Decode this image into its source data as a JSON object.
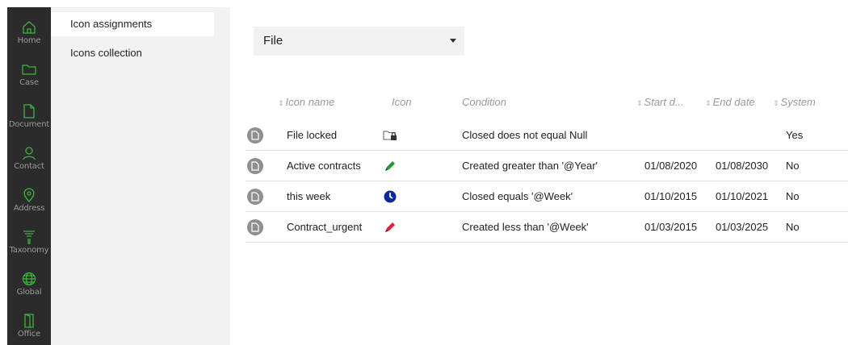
{
  "rail": {
    "items": [
      {
        "label": "Home",
        "icon": "home-icon"
      },
      {
        "label": "Case",
        "icon": "folder-icon"
      },
      {
        "label": "Document",
        "icon": "document-icon"
      },
      {
        "label": "Contact",
        "icon": "person-icon"
      },
      {
        "label": "Address",
        "icon": "location-pin-icon"
      },
      {
        "label": "Taxonomy",
        "icon": "funnel-icon"
      },
      {
        "label": "Global",
        "icon": "globe-icon"
      },
      {
        "label": "Office",
        "icon": "door-icon"
      }
    ],
    "accent": "#3db23d"
  },
  "subnav": {
    "items": [
      {
        "label": "Icon assignments",
        "active": true
      },
      {
        "label": "Icons collection",
        "active": false
      }
    ]
  },
  "filter": {
    "selected": "File"
  },
  "table": {
    "columns": [
      "Icon name",
      "Icon",
      "Condition",
      "Start d...",
      "End date",
      "System"
    ],
    "rows": [
      {
        "name": "File locked",
        "icon": "folder-lock-icon",
        "condition": "Closed does not equal Null",
        "start": "",
        "end": "",
        "system": "Yes"
      },
      {
        "name": "Active contracts",
        "icon": "green-pen-icon",
        "condition": "Created greater than '@Year'",
        "start": "01/08/2020",
        "end": "01/08/2030",
        "system": "No"
      },
      {
        "name": "this week",
        "icon": "blue-clock-icon",
        "condition": "Closed equals '@Week'",
        "start": "01/10/2015",
        "end": "01/10/2021",
        "system": "No"
      },
      {
        "name": "Contract_urgent",
        "icon": "red-pen-icon",
        "condition": "Created less than '@Week'",
        "start": "01/03/2015",
        "end": "01/03/2025",
        "system": "No"
      }
    ]
  }
}
